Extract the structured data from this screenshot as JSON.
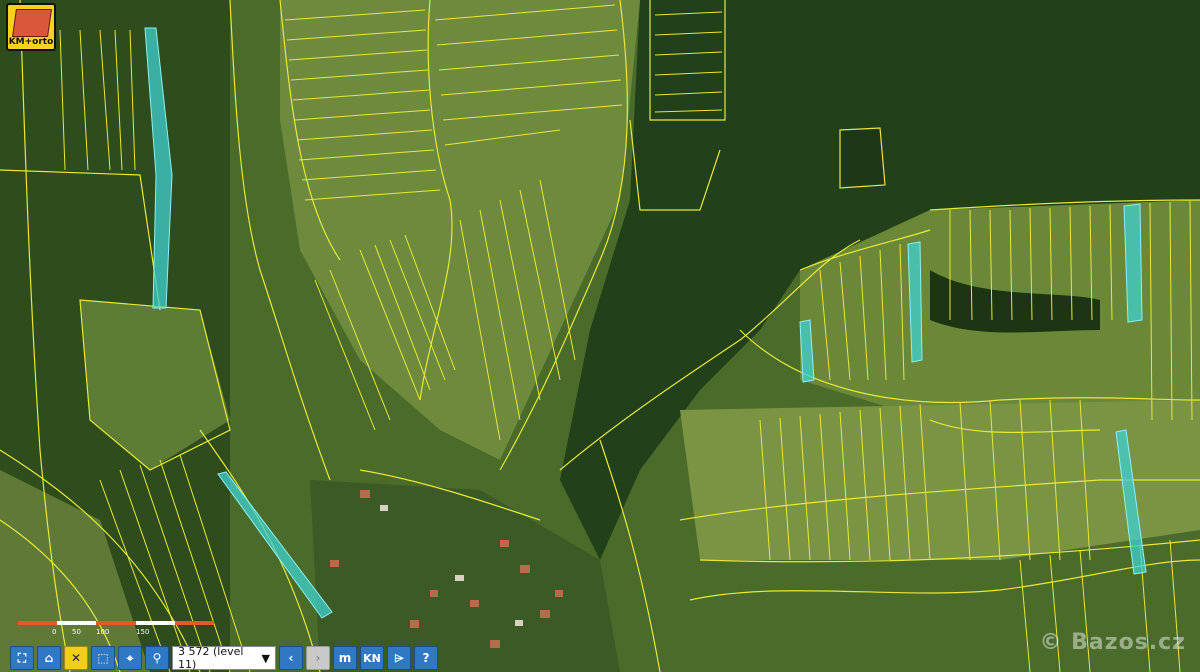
{
  "logo": {
    "text": "KM+orto"
  },
  "scale": {
    "labels": [
      "0",
      "50",
      "100",
      "150"
    ]
  },
  "toolbar": {
    "zoom_select_value": "3 572 (level 11)",
    "kn_label": "KN",
    "m_label": "m",
    "help_label": "?"
  },
  "watermark": "© Bazos.cz",
  "colors": {
    "parcel_lines": "#e8e83a",
    "highlight": "#3fd0d0",
    "toolbar_blue": "#2f78c4"
  }
}
